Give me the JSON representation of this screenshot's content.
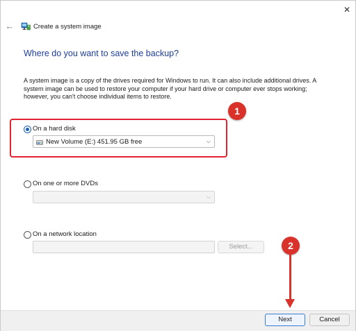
{
  "window": {
    "title": "Create a system image",
    "close_glyph": "✕",
    "back_glyph": "←"
  },
  "heading": "Where do you want to save the backup?",
  "description": "A system image is a copy of the drives required for Windows to run. It can also include additional drives. A system image can be used to restore your computer if your hard drive or computer ever stops working; however, you can't choose individual items to restore.",
  "options": {
    "hard_disk": {
      "label": "On a hard disk",
      "selected": true,
      "drive_value": "New Volume (E:)  451.95 GB free"
    },
    "dvds": {
      "label": "On one or more DVDs",
      "selected": false,
      "drive_value": ""
    },
    "network": {
      "label": "On a network location",
      "selected": false,
      "path_value": "",
      "select_button": "Select..."
    }
  },
  "buttons": {
    "next": "Next",
    "cancel": "Cancel"
  },
  "annotations": {
    "badge_1": "1",
    "badge_2": "2"
  },
  "colors": {
    "heading": "#1e3c9a",
    "accent": "#1e5fb3",
    "annotation_red": "#d9322b"
  },
  "icons": {
    "app": "system-image-backup-icon",
    "drive": "hard-drive-icon",
    "chevron": "chevron-down-icon"
  }
}
